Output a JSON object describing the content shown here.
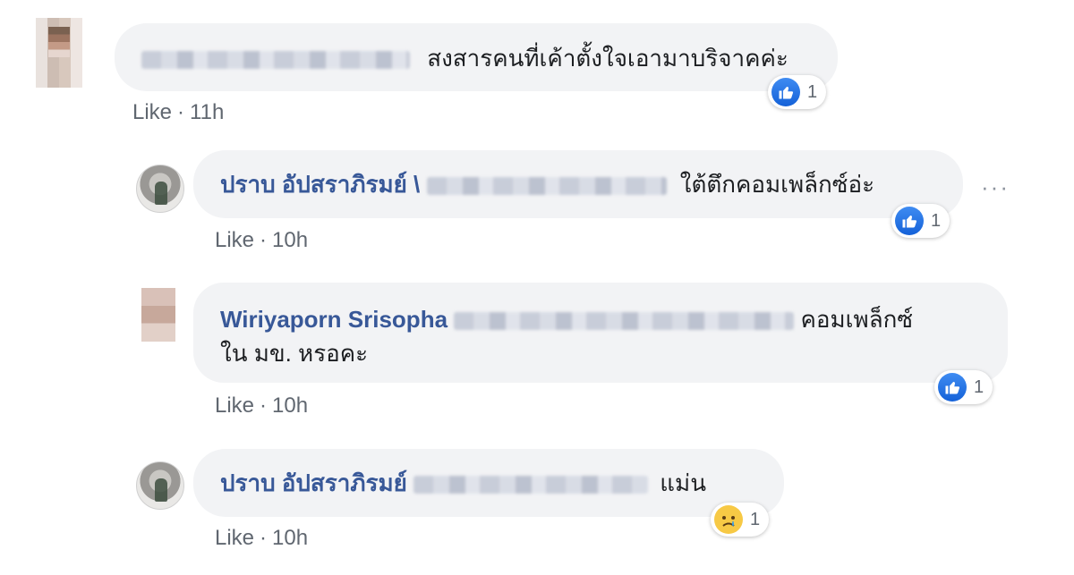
{
  "comments": [
    {
      "author": "",
      "text": "สงสารคนที่เค้าตั้งใจเอามาบริจาคค่ะ",
      "meta": {
        "like": "Like",
        "sep": "·",
        "time": "11h"
      },
      "reaction": {
        "icon": "like-icon",
        "count": "1"
      }
    },
    {
      "author": "ปราบ อัปสราภิรมย์ \\",
      "text": "ใต้ตึกคอมเพล็กซ์อ่ะ",
      "meta": {
        "like": "Like",
        "sep": "·",
        "time": "10h"
      },
      "reaction": {
        "icon": "like-icon",
        "count": "1"
      },
      "more": "···"
    },
    {
      "author": "Wiriyaporn Srisopha",
      "text_line1": "คอมเพล็กซ์",
      "text_line2": "ใน มข. หรอคะ",
      "meta": {
        "like": "Like",
        "sep": "·",
        "time": "10h"
      },
      "reaction": {
        "icon": "like-icon",
        "count": "1"
      }
    },
    {
      "author": "ปราบ อัปสราภิรมย์",
      "text": "แม่น",
      "meta": {
        "like": "Like",
        "sep": "·",
        "time": "10h"
      },
      "reaction": {
        "icon": "sad-icon",
        "count": "1"
      }
    }
  ],
  "colors": {
    "author": "#385898",
    "bubble": "#f2f3f5",
    "meta": "#606770",
    "like_blue": "#1877f2"
  }
}
